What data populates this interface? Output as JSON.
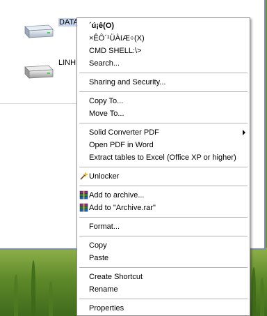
{
  "explorer": {
    "drives": [
      {
        "label": "DATA",
        "icon": "hard-drive-icon"
      },
      {
        "label": "LINH",
        "icon": "hard-drive-icon"
      }
    ]
  },
  "context_menu": {
    "items": [
      {
        "label": "´ú¡ê(O)",
        "bold": true
      },
      {
        "label": "×ÊÔ´¹ÜÀíÆ÷(X)"
      },
      {
        "label": "CMD SHELL:\\>"
      },
      {
        "label": "Search..."
      },
      {
        "label": "Sharing and Security..."
      },
      {
        "label": "Copy To..."
      },
      {
        "label": "Move To..."
      },
      {
        "label": "Solid Converter PDF",
        "submenu": true
      },
      {
        "label": "Open PDF in Word"
      },
      {
        "label": "Extract tables to Excel (Office XP or higher)"
      },
      {
        "label": "Unlocker",
        "icon": "unlocker-wand-icon"
      },
      {
        "label": "Add to archive...",
        "icon": "winrar-books-icon"
      },
      {
        "label": "Add to \"Archive.rar\"",
        "icon": "winrar-books-icon"
      },
      {
        "label": "Format..."
      },
      {
        "label": "Copy"
      },
      {
        "label": "Paste"
      },
      {
        "label": "Create Shortcut"
      },
      {
        "label": "Rename"
      },
      {
        "label": "Properties"
      }
    ]
  },
  "colors": {
    "menu_background": "#ffffff",
    "separator": "#b5b5b5",
    "selection_highlight": "#c5d5ee",
    "wallpaper_green": "#5f8a2a"
  }
}
